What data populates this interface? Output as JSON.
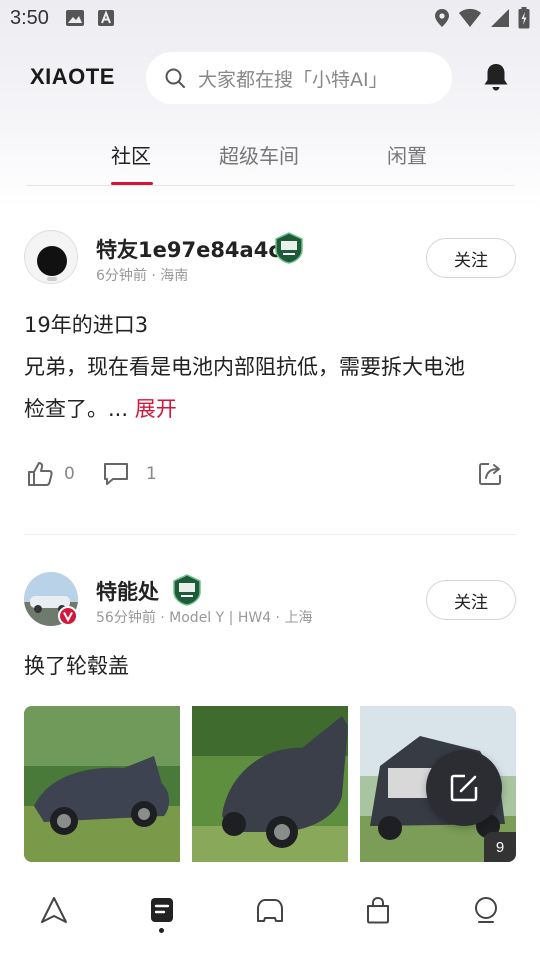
{
  "status_bar": {
    "time": "3:50"
  },
  "header": {
    "logo": "XIAOTE",
    "search_placeholder": "大家都在搜「小特AI」"
  },
  "tabs": [
    {
      "label": "社区",
      "active": true
    },
    {
      "label": "超级车间",
      "active": false
    },
    {
      "label": "闲置",
      "active": false
    }
  ],
  "posts": [
    {
      "username": "特友1e97e84a4c",
      "meta": "6分钟前 · 海南",
      "follow_label": "关注",
      "title": "19年的进口3",
      "body": "兄弟，现在看是电池内部阻抗低，需要拆大电池",
      "body_line2": "检查了。...",
      "expand_label": "展开",
      "likes": "0",
      "comments": "1"
    },
    {
      "username": "特能处",
      "meta": "56分钟前 · Model Y | HW4 · 上海",
      "follow_label": "关注",
      "title": "换了轮毂盖",
      "photo_count": "9"
    }
  ],
  "colors": {
    "accent": "#d3163a",
    "fab": "#2b2d33"
  }
}
